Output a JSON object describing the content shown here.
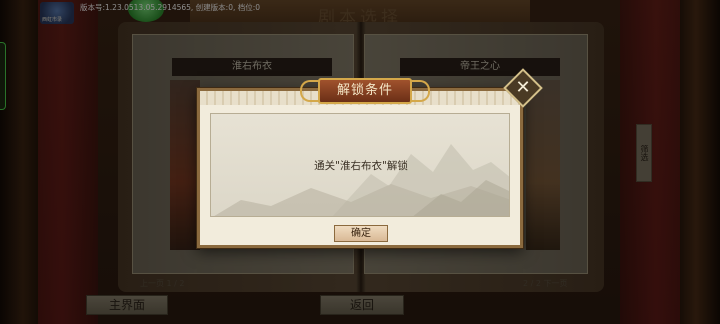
{
  "header": {
    "title": "剧本选择",
    "version": "版本号:1.23.0513.05.2914565, 创建版本:0, 档位:0",
    "logo_text": "西虹市录"
  },
  "book": {
    "left_title": "淮右布衣",
    "right_title": "帝王之心",
    "filter_label": "筛选",
    "prev_page": "上一页 1 / 2",
    "next_page": "2 / 2 下一页"
  },
  "nav": {
    "main_label": "主界面",
    "back_label": "返回"
  },
  "modal": {
    "title": "解锁条件",
    "message": "通关\"淮右布衣\"解锁",
    "confirm_label": "确定",
    "close_glyph": "✕"
  },
  "colors": {
    "modal_border": "#8b6a3e",
    "plaque": "#a0522d",
    "plaque_border": "#d4a84a",
    "side_tab": "#4bd24b"
  }
}
